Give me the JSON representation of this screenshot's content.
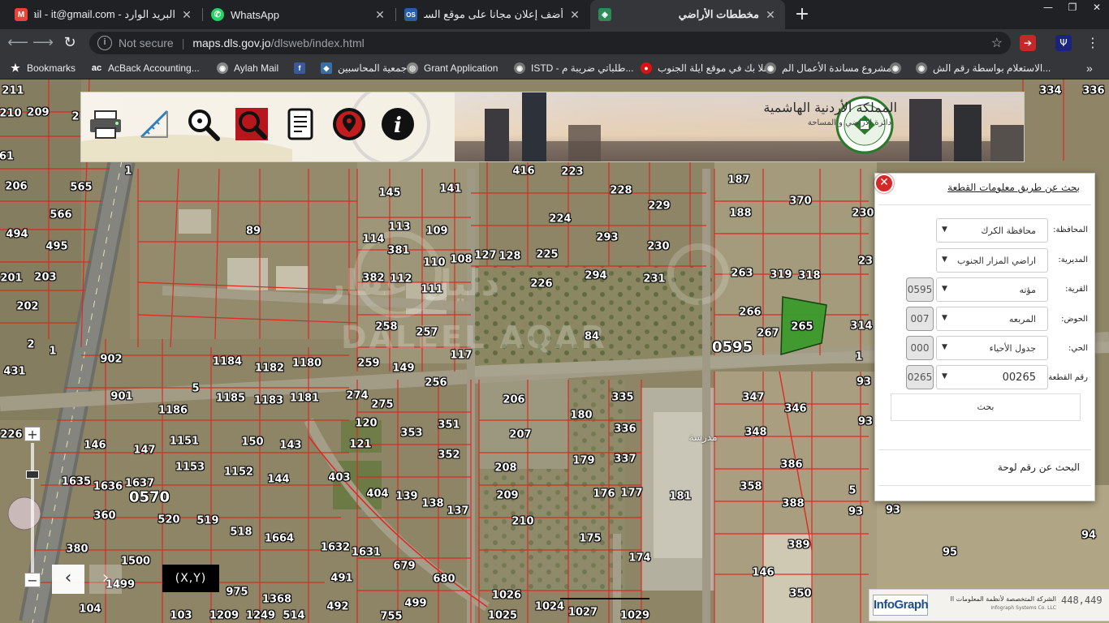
{
  "browser": {
    "tabs": [
      {
        "title": "البريد الوارد - Gmail - it@gmail.com",
        "favicon": "gmail-icon",
        "color": "#ea4335",
        "glyph": "M"
      },
      {
        "title": "WhatsApp",
        "favicon": "whatsapp-icon",
        "color": "#25d366",
        "glyph": "✆"
      },
      {
        "title": "أضف إعلان مجانا على موقع السوق المفتوح",
        "favicon": "opensooq-icon",
        "color": "#2a5caa",
        "glyph": "OS"
      },
      {
        "title": "مخططات الأراضي",
        "favicon": "map-icon",
        "color": "#2e8b57",
        "glyph": "◈",
        "active": true
      }
    ],
    "window_controls": {
      "minimize": "—",
      "maximize": "❐",
      "close": "✕"
    },
    "address": {
      "security_label": "Not secure",
      "host": "maps.dls.gov.jo",
      "path": "/dlsweb/index.html"
    },
    "bookmarks": [
      {
        "label": "Bookmarks",
        "icon": "star-icon",
        "glyph": "★",
        "color": "transparent"
      },
      {
        "label": "AcBack Accounting...",
        "icon": "acback-icon",
        "glyph": "ac",
        "color": "transparent"
      },
      {
        "label": "Aylah Mail",
        "icon": "globe-icon",
        "glyph": "◉",
        "color": "#888"
      },
      {
        "label": "",
        "icon": "facebook-icon",
        "glyph": "f",
        "color": "#3b5998"
      },
      {
        "label": "جمعية المحاسبين",
        "icon": "association-icon",
        "glyph": "◆",
        "color": "#3a6ea5"
      },
      {
        "label": "Grant Application",
        "icon": "grant-icon",
        "glyph": "◎",
        "color": "#888"
      },
      {
        "label": "ISTD - طلباتي ضريبة م...",
        "icon": "istd-icon",
        "glyph": "◉",
        "color": "#777"
      },
      {
        "label": "اهلا بك في موقع ايلة الجنوب",
        "icon": "aylah-icon",
        "glyph": "●",
        "color": "#d11"
      },
      {
        "label": "مشروع مساندة الأعمال الم...",
        "icon": "globe-icon",
        "glyph": "◉",
        "color": "#777"
      },
      {
        "label": "",
        "icon": "globe-icon",
        "glyph": "◉",
        "color": "#777"
      },
      {
        "label": "الاستعلام بواسطة رقم الش...",
        "icon": "globe-icon",
        "glyph": "◉",
        "color": "#777"
      }
    ]
  },
  "banner": {
    "title": "المملكة الأردنية الهاشمية",
    "subtitle": "دائرة الأراضي و المساحة",
    "tools": [
      {
        "name": "print-icon"
      },
      {
        "name": "measure-icon"
      },
      {
        "name": "identify-icon"
      },
      {
        "name": "search-icon"
      },
      {
        "name": "report-icon"
      },
      {
        "name": "location-icon"
      },
      {
        "name": "info-icon"
      }
    ]
  },
  "panel": {
    "title": "بحث عن طريق معلومات القطعة",
    "rows": [
      {
        "label": "المحافظة:",
        "value": "محافظة الكرك",
        "code": ""
      },
      {
        "label": "المديرية:",
        "value": "اراضي المزار الجنوب",
        "code": ""
      },
      {
        "label": "القرية:",
        "value": "مؤته",
        "code": "0595"
      },
      {
        "label": "الحوض:",
        "value": "المربعه",
        "code": "007"
      },
      {
        "label": "الحي:",
        "value": "جدول الأحياء",
        "code": "000"
      },
      {
        "label": "رقم القطعة:",
        "value": "00265",
        "code": "0265"
      }
    ],
    "search_button": "بحث",
    "plate_link": "البحث عن رقم لوحة"
  },
  "map": {
    "parcels": [
      [
        "211",
        16,
        14
      ],
      [
        "209",
        47,
        41
      ],
      [
        "210",
        13,
        42
      ],
      [
        "2",
        93,
        46
      ],
      [
        "61",
        8,
        95
      ],
      [
        "206",
        20,
        132
      ],
      [
        "565",
        100,
        133
      ],
      [
        "566",
        75,
        167
      ],
      [
        "494",
        21,
        191
      ],
      [
        "495",
        70,
        206
      ],
      [
        "201",
        14,
        245
      ],
      [
        "203",
        56,
        244
      ],
      [
        "202",
        34,
        280
      ],
      [
        "2",
        38,
        327
      ],
      [
        "1",
        65,
        335
      ],
      [
        "431",
        18,
        360
      ],
      [
        "902",
        137,
        345
      ],
      [
        "901",
        150,
        391
      ],
      [
        "5",
        241,
        381
      ],
      [
        "1186",
        213,
        408
      ],
      [
        "1184",
        280,
        348
      ],
      [
        "1182",
        332,
        356
      ],
      [
        "1180",
        378,
        350
      ],
      [
        "1185",
        284,
        393
      ],
      [
        "1183",
        331,
        396
      ],
      [
        "1181",
        375,
        393
      ],
      [
        "226",
        14,
        438
      ],
      [
        "146",
        117,
        451
      ],
      [
        "147",
        178,
        457
      ],
      [
        "1151",
        227,
        446
      ],
      [
        "1153",
        234,
        478
      ],
      [
        "150",
        311,
        447
      ],
      [
        "143",
        358,
        451
      ],
      [
        "1152",
        294,
        484
      ],
      [
        "144",
        343,
        493
      ],
      [
        "1635",
        94,
        496
      ],
      [
        "1636",
        133,
        502
      ],
      [
        "1637",
        172,
        498
      ],
      [
        "360",
        129,
        538
      ],
      [
        "520",
        208,
        543
      ],
      [
        "519",
        256,
        544
      ],
      [
        "518",
        297,
        558
      ],
      [
        "1664",
        344,
        566
      ],
      [
        "380",
        95,
        579
      ],
      [
        "1500",
        167,
        594
      ],
      [
        "1499",
        148,
        623
      ],
      [
        "975",
        292,
        632
      ],
      [
        "104",
        111,
        653
      ],
      [
        "103",
        223,
        661
      ],
      [
        "1209",
        276,
        661
      ],
      [
        "1249",
        321,
        661
      ],
      [
        "514",
        362,
        661
      ],
      [
        "1368",
        341,
        641
      ],
      [
        "1632",
        413,
        577
      ],
      [
        "1631",
        451,
        583
      ],
      [
        "491",
        421,
        615
      ],
      [
        "492",
        416,
        650
      ],
      [
        "679",
        498,
        600
      ],
      [
        "680",
        547,
        616
      ],
      [
        "499",
        512,
        646
      ],
      [
        "755",
        482,
        662
      ],
      [
        "1026",
        624,
        636
      ],
      [
        "1025",
        619,
        661
      ],
      [
        "1024",
        677,
        650
      ],
      [
        "1027",
        718,
        657
      ],
      [
        "1029",
        782,
        661
      ],
      [
        "174",
        788,
        590
      ],
      [
        "175",
        727,
        566
      ],
      [
        "146",
        940,
        608
      ],
      [
        "350",
        986,
        634
      ],
      [
        "389",
        984,
        574
      ],
      [
        "388",
        977,
        523
      ],
      [
        "386",
        975,
        475
      ],
      [
        "358",
        925,
        502
      ],
      [
        "348",
        931,
        435
      ],
      [
        "347",
        928,
        392
      ],
      [
        "346",
        980,
        406
      ],
      [
        "93",
        1054,
        533
      ],
      [
        "95",
        1170,
        583
      ],
      [
        "94",
        1341,
        562
      ],
      [
        "93",
        1100,
        531
      ],
      [
        "5",
        1050,
        507
      ],
      [
        "1",
        1058,
        342
      ],
      [
        "93",
        1064,
        373
      ],
      [
        "93",
        1066,
        422
      ],
      [
        "314",
        1061,
        304
      ],
      [
        "230",
        1063,
        165
      ],
      [
        "23",
        1066,
        224
      ],
      [
        "336",
        1347,
        14
      ],
      [
        "334",
        1294,
        14
      ],
      [
        "89",
        312,
        187
      ],
      [
        "114",
        460,
        197
      ],
      [
        "113",
        492,
        182
      ],
      [
        "109",
        538,
        187
      ],
      [
        "381",
        491,
        211
      ],
      [
        "110",
        535,
        226
      ],
      [
        "108",
        568,
        222
      ],
      [
        "127",
        598,
        217
      ],
      [
        "128",
        628,
        218
      ],
      [
        "225",
        674,
        216
      ],
      [
        "382",
        460,
        245
      ],
      [
        "112",
        494,
        246
      ],
      [
        "111",
        532,
        259
      ],
      [
        "226",
        667,
        252
      ],
      [
        "294",
        734,
        242
      ],
      [
        "231",
        806,
        246
      ],
      [
        "263",
        914,
        239
      ],
      [
        "319",
        962,
        241
      ],
      [
        "318",
        997,
        242
      ],
      [
        "266",
        924,
        287
      ],
      [
        "267",
        946,
        313
      ],
      [
        "265",
        988,
        305
      ],
      [
        "258",
        476,
        305
      ],
      [
        "257",
        526,
        312
      ],
      [
        "84",
        729,
        317
      ],
      [
        "117",
        568,
        340
      ],
      [
        "259",
        454,
        350
      ],
      [
        "149",
        497,
        356
      ],
      [
        "256",
        537,
        374
      ],
      [
        "274",
        440,
        390
      ],
      [
        "275",
        471,
        401
      ],
      [
        "120",
        451,
        424
      ],
      [
        "353",
        507,
        436
      ],
      [
        "351",
        553,
        426
      ],
      [
        "121",
        444,
        450
      ],
      [
        "352",
        553,
        463
      ],
      [
        "206",
        633,
        395
      ],
      [
        "180",
        716,
        414
      ],
      [
        "335",
        767,
        392
      ],
      [
        "336",
        770,
        431
      ],
      [
        "207",
        641,
        438
      ],
      [
        "179",
        719,
        470
      ],
      [
        "337",
        770,
        468
      ],
      [
        "208",
        623,
        479
      ],
      [
        "403",
        418,
        491
      ],
      [
        "404",
        465,
        511
      ],
      [
        "139",
        501,
        514
      ],
      [
        "138",
        533,
        523
      ],
      [
        "137",
        564,
        532
      ],
      [
        "209",
        625,
        513
      ],
      [
        "176",
        744,
        511
      ],
      [
        "177",
        778,
        510
      ],
      [
        "181",
        838,
        514
      ],
      [
        "210",
        644,
        545
      ],
      [
        "416",
        645,
        113
      ],
      [
        "223",
        705,
        114
      ],
      [
        "145",
        480,
        140
      ],
      [
        "141",
        555,
        135
      ],
      [
        "228",
        765,
        137
      ],
      [
        "229",
        812,
        156
      ],
      [
        "187",
        910,
        124
      ],
      [
        "370",
        986,
        150
      ],
      [
        "188",
        912,
        165
      ],
      [
        "224",
        690,
        172
      ],
      [
        "293",
        748,
        195
      ],
      [
        "230",
        811,
        206
      ],
      [
        "1",
        158,
        113
      ],
      [
        "2",
        1296,
        183
      ]
    ],
    "blocks": [
      [
        "0595",
        902,
        330
      ],
      [
        "0570",
        184,
        515
      ]
    ],
    "poi": [
      [
        "مدرسة",
        866,
        441
      ]
    ],
    "highlight_label": "265",
    "watermark_ar": "دليل عقار",
    "watermark_en": "DALEEL AQAR",
    "zoom_in": "+",
    "zoom_out": "−",
    "pan_left": "‹",
    "pan_right": "›",
    "xy_label": "(X,Y)",
    "infograph_label": "InfoGraph",
    "infograph_arabic": "الشركة المتخصصة لأنظمة المعلومات الجغرافية",
    "infograph_english": "Infograph Systems Co. LLC",
    "coord_text": "448,449"
  }
}
